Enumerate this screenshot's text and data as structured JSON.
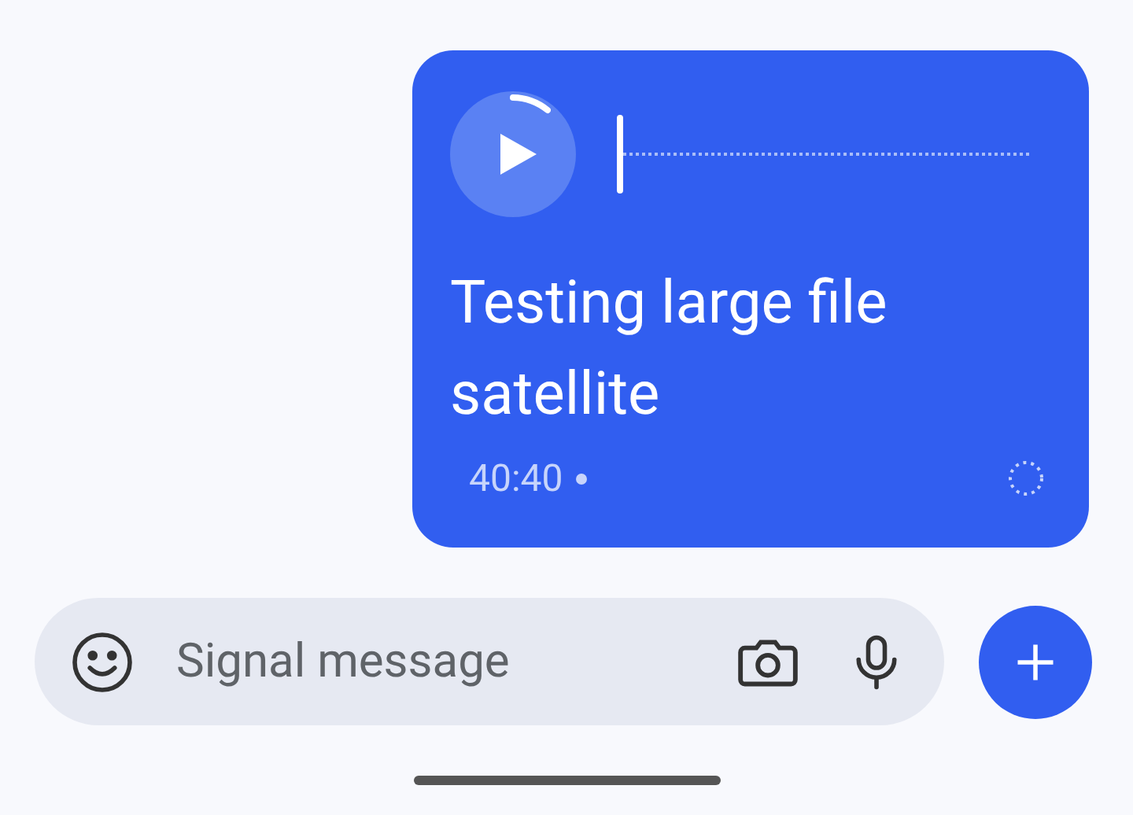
{
  "message": {
    "audio": {
      "level": 0
    },
    "text": "Testing large file satellite",
    "time": "40:40"
  },
  "composer": {
    "placeholder": "Signal message"
  }
}
